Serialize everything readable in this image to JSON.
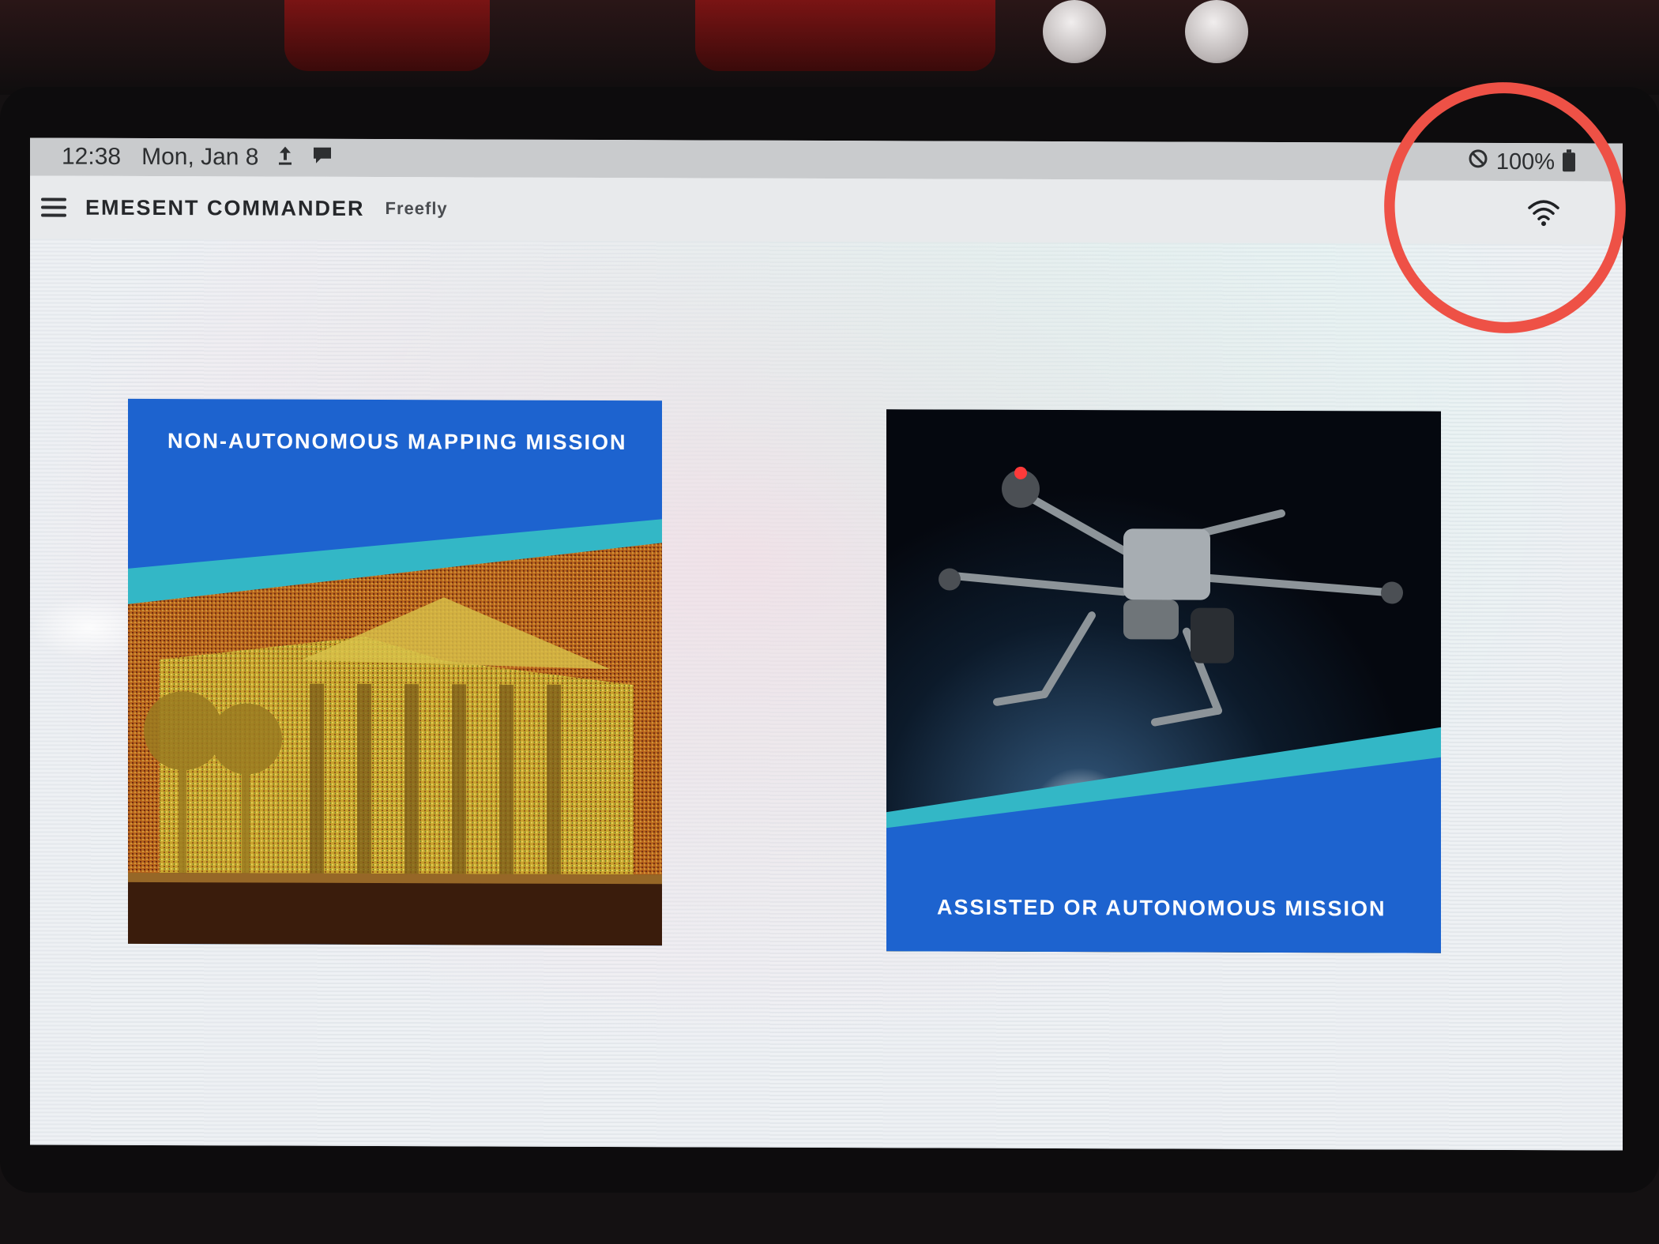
{
  "status_bar": {
    "time": "12:38",
    "date": "Mon, Jan 8",
    "upload_icon": "upload-icon",
    "notification_icon": "message-icon",
    "dnd_icon": "do-not-disturb-icon",
    "battery_percent": "100%",
    "battery_icon": "battery-full-icon"
  },
  "app_bar": {
    "menu_icon": "hamburger-menu-icon",
    "title": "EMESENT COMMANDER",
    "subtitle": "Freefly",
    "connection_icon": "wifi-icon"
  },
  "missions": [
    {
      "label": "NON-AUTONOMOUS MAPPING MISSION",
      "image": "point-cloud-building"
    },
    {
      "label": "ASSISTED OR AUTONOMOUS MISSION",
      "image": "drone-in-tunnel"
    }
  ],
  "colors": {
    "card_blue": "#1d63cf",
    "card_teal": "#33b7c6",
    "annotation_red": "#ee5146"
  }
}
